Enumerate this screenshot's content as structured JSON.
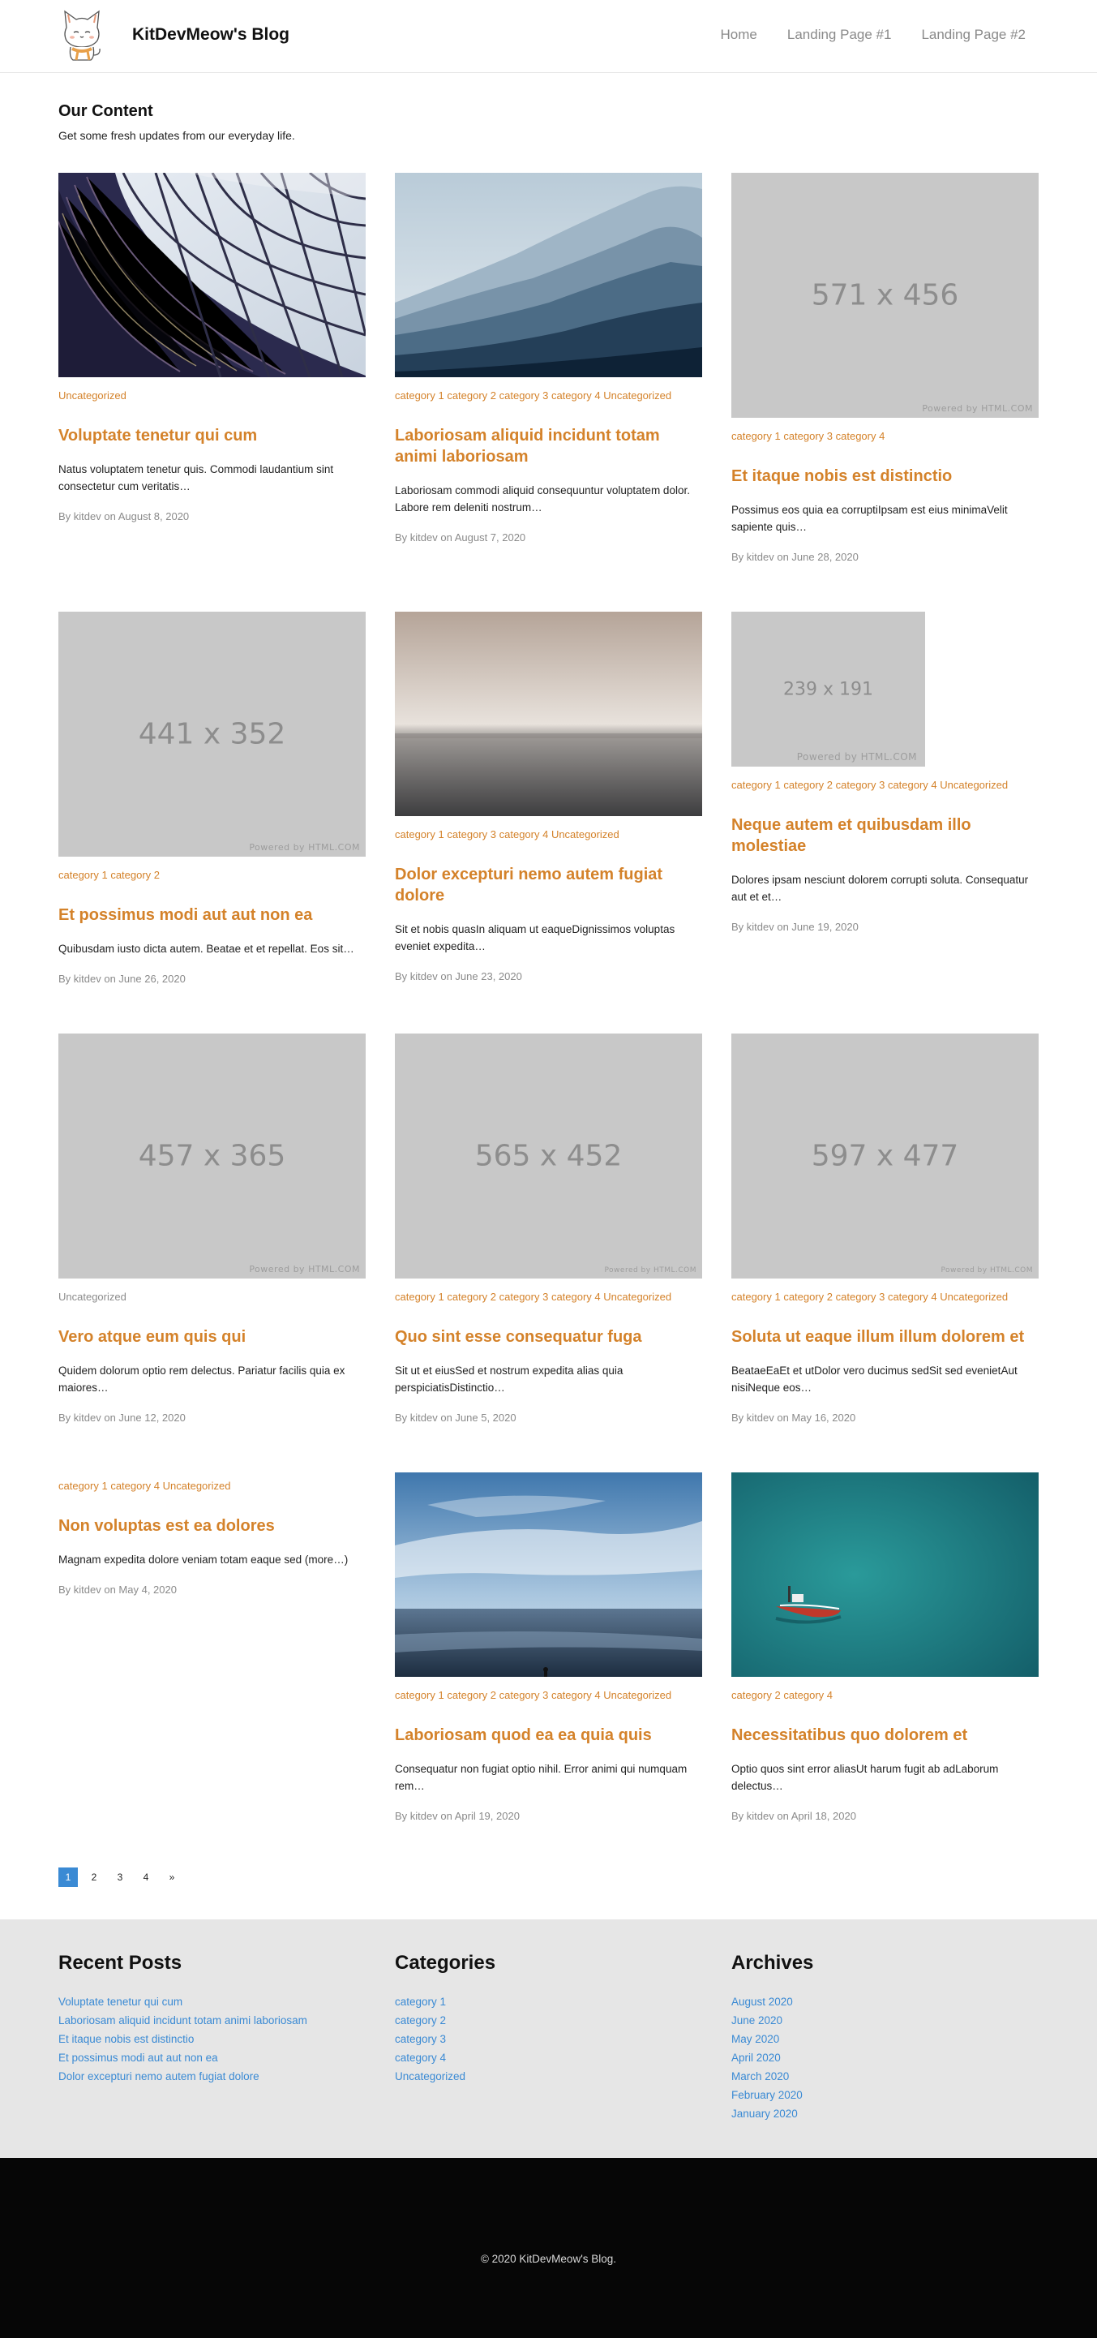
{
  "site": {
    "title": "KitDevMeow's Blog",
    "nav": [
      "Home",
      "Landing Page #1",
      "Landing Page #2"
    ]
  },
  "content": {
    "heading": "Our Content",
    "subheading": "Get some fresh updates from our everyday life."
  },
  "posts": [
    {
      "image": "photo-library",
      "categories": "Uncategorized",
      "title": "Voluptate tenetur qui cum",
      "excerpt": "Natus voluptatem tenetur quis. Commodi laudantium sint consectetur cum veritatis…",
      "byline": "By kitdev on August 8, 2020"
    },
    {
      "image": "photo-mountains",
      "categories": "category 1 category 2 category 3 category 4 Uncategorized",
      "title": "Laboriosam aliquid incidunt totam animi laboriosam",
      "excerpt": "Laboriosam commodi aliquid consequuntur voluptatem dolor. Labore rem deleniti nostrum…",
      "byline": "By kitdev on August 7, 2020"
    },
    {
      "image": "placeholder",
      "dim": "571 x 456",
      "powered": "Powered by HTML.COM",
      "categories": "category 1 category 3 category 4",
      "title": "Et itaque nobis est distinctio",
      "excerpt": "Possimus eos quia ea corruptiIpsam est eius minimaVelit sapiente quis…",
      "byline": "By kitdev on June 28, 2020"
    },
    {
      "image": "placeholder",
      "dim": "441 x 352",
      "powered": "Powered by HTML.COM",
      "categories": "category 1 category 2",
      "title": "Et possimus modi aut aut non ea",
      "excerpt": "Quibusdam iusto dicta autem. Beatae et et repellat. Eos sit…",
      "byline": "By kitdev on June 26, 2020"
    },
    {
      "image": "photo-sea-fog",
      "categories": "category 1 category 3 category 4 Uncategorized",
      "title": "Dolor excepturi nemo autem fugiat dolore",
      "excerpt": "Sit et nobis quasIn aliquam ut eaqueDignissimos voluptas eveniet expedita…",
      "byline": "By kitdev on June 23, 2020"
    },
    {
      "image": "placeholder-small",
      "dim": "239 x 191",
      "powered": "Powered by HTML.COM",
      "categories": "category 1 category 2 category 3 category 4 Uncategorized",
      "title": "Neque autem et quibusdam illo molestiae",
      "excerpt": "Dolores ipsam nesciunt dolorem corrupti soluta. Consequatur aut et et…",
      "byline": "By kitdev on June 19, 2020"
    },
    {
      "image": "placeholder",
      "dim": "457 x 365",
      "powered": "Powered by HTML.COM",
      "categories": "Uncategorized",
      "title": "Vero atque eum quis qui",
      "excerpt": "Quidem dolorum optio rem delectus. Pariatur facilis quia ex maiores…",
      "byline": "By kitdev on June 12, 2020"
    },
    {
      "image": "placeholder",
      "dim": "565 x 452",
      "powered": "Powered by HTML.COM",
      "categories": "category 1 category 2 category 3 category 4 Uncategorized",
      "title": "Quo sint esse consequatur fuga",
      "excerpt": "Sit ut et eiusSed et nostrum expedita alias quia perspiciatisDistinctio…",
      "byline": "By kitdev on June 5, 2020"
    },
    {
      "image": "placeholder",
      "dim": "597 x 477",
      "powered": "Powered by HTML.COM",
      "categories": "category 1 category 2 category 3 category 4 Uncategorized",
      "title": "Soluta ut eaque illum illum dolorem et",
      "excerpt": "BeataeEaEt et utDolor vero ducimus sedSit sed evenietAut nisiNeque eos…",
      "byline": "By kitdev on May 16, 2020"
    },
    {
      "image": "none",
      "categories": "category 1 category 4 Uncategorized",
      "title": "Non voluptas est ea dolores",
      "excerpt": "Magnam expedita dolore veniam totam eaque sed (more…)",
      "byline": "By kitdev on May 4, 2020"
    },
    {
      "image": "photo-beach",
      "categories": "category 1 category 2 category 3 category 4 Uncategorized",
      "title": "Laboriosam quod ea ea quia quis",
      "excerpt": "Consequatur non fugiat optio nihil. Error animi qui numquam rem…",
      "byline": "By kitdev on April 19, 2020"
    },
    {
      "image": "photo-boat",
      "categories": "category 2 category 4",
      "title": "Necessitatibus quo dolorem et",
      "excerpt": "Optio quos sint error aliasUt harum fugit ab adLaborum delectus…",
      "byline": "By kitdev on April 18, 2020"
    }
  ],
  "pagination": {
    "pages": [
      "1",
      "2",
      "3",
      "4"
    ],
    "next": "»",
    "current": "1"
  },
  "widgets": {
    "recent": {
      "title": "Recent Posts",
      "items": [
        "Voluptate tenetur qui cum",
        "Laboriosam aliquid incidunt totam animi laboriosam",
        "Et itaque nobis est distinctio",
        "Et possimus modi aut aut non ea",
        "Dolor excepturi nemo autem fugiat dolore"
      ]
    },
    "categories": {
      "title": "Categories",
      "items": [
        "category 1",
        "category 2",
        "category 3",
        "category 4",
        "Uncategorized"
      ]
    },
    "archives": {
      "title": "Archives",
      "items": [
        "August 2020",
        "June 2020",
        "May 2020",
        "April 2020",
        "March 2020",
        "February 2020",
        "January 2020"
      ]
    }
  },
  "footer": {
    "copyright": "© 2020 KitDevMeow's Blog."
  },
  "colors": {
    "accent": "#d4822a",
    "link": "#3a8ad4",
    "placeholder": "#c8c8c8"
  }
}
